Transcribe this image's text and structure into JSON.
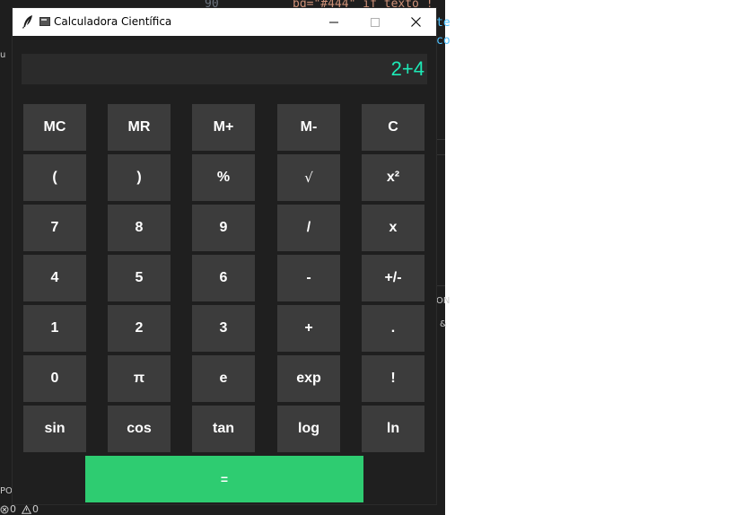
{
  "window": {
    "title": "Calculadora Científica",
    "title_icon": "feather-icon",
    "controls": [
      "minimize-icon",
      "maximize-icon",
      "close-icon"
    ]
  },
  "display": {
    "value": "2+4",
    "color": "#1de9b6"
  },
  "keys": [
    [
      "MC",
      "MR",
      "M+",
      "M-",
      "C"
    ],
    [
      "(",
      ")",
      "%",
      "√",
      "x²"
    ],
    [
      "7",
      "8",
      "9",
      "/",
      "x"
    ],
    [
      "4",
      "5",
      "6",
      "-",
      "+/-"
    ],
    [
      "1",
      "2",
      "3",
      "+",
      "."
    ],
    [
      "0",
      "π",
      "e",
      "exp",
      "!"
    ],
    [
      "sin",
      "cos",
      "tan",
      "log",
      "ln"
    ]
  ],
  "equals_label": "=",
  "colors": {
    "window_bg": "#1f1f1f",
    "key_bg": "#3c3c3c",
    "equals_bg": "#2ecc71"
  },
  "background_editor": {
    "line1": "bg=\"#444\" if texto !",
    "line_num": "90",
    "frag2": "te",
    "frag3": "co",
    "side1": "ON",
    "side2": "&",
    "side3": "PO",
    "status_errors": "0",
    "status_warnings": "0"
  }
}
